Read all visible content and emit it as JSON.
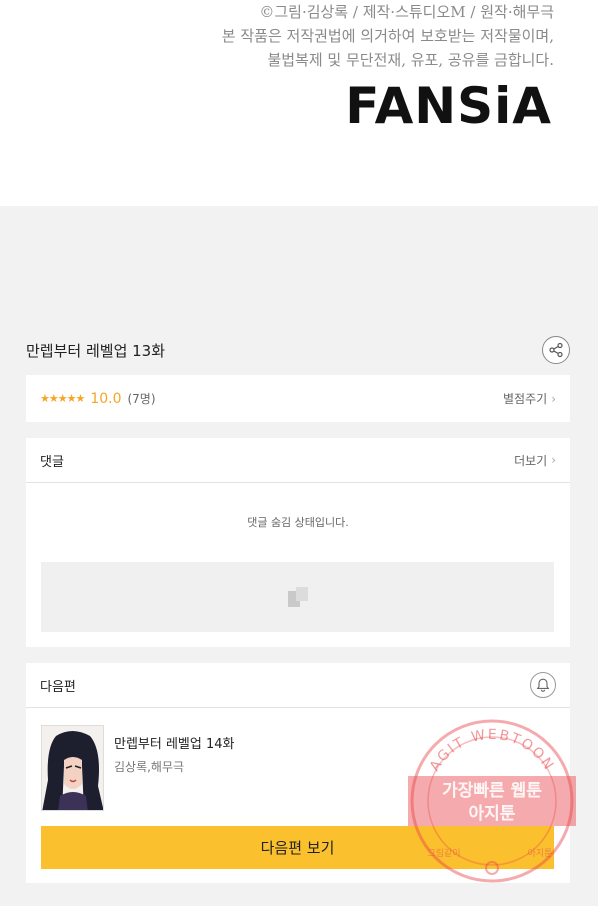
{
  "comic_end": {
    "copyright_lines": [
      "©그림·김상록 / 제작·스튜디오M / 원작·해무극",
      "본 작품은 저작권법에 의거하여 보호받는 저작물이며,",
      "불법복제 및 무단전재, 유포, 공유를 금합니다."
    ],
    "logo_text": "FANSiA"
  },
  "episode": {
    "title": "만렙부터 레벨업 13화"
  },
  "rating": {
    "stars": "★★★★★",
    "score": "10.0",
    "count": "(7명)",
    "action_label": "별점주기"
  },
  "comments": {
    "header": "댓글",
    "more_label": "더보기",
    "hidden_message": "댓글 숨김 상태입니다."
  },
  "next": {
    "header": "다음편",
    "title": "만렙부터 레벨업 14화",
    "author": "김상록,해무극",
    "button_label": "다음편 보기"
  },
  "watermark": {
    "ring_text": "AGIT WEBTOON",
    "line1": "가장빠른 웹툰",
    "line2": "아지툰",
    "bottom_left": "그림같이",
    "bottom_right": "아지툰"
  },
  "colors": {
    "accent_yellow": "#fbc02d",
    "star_orange": "#f5a623",
    "stamp_red": "#e8454a"
  }
}
